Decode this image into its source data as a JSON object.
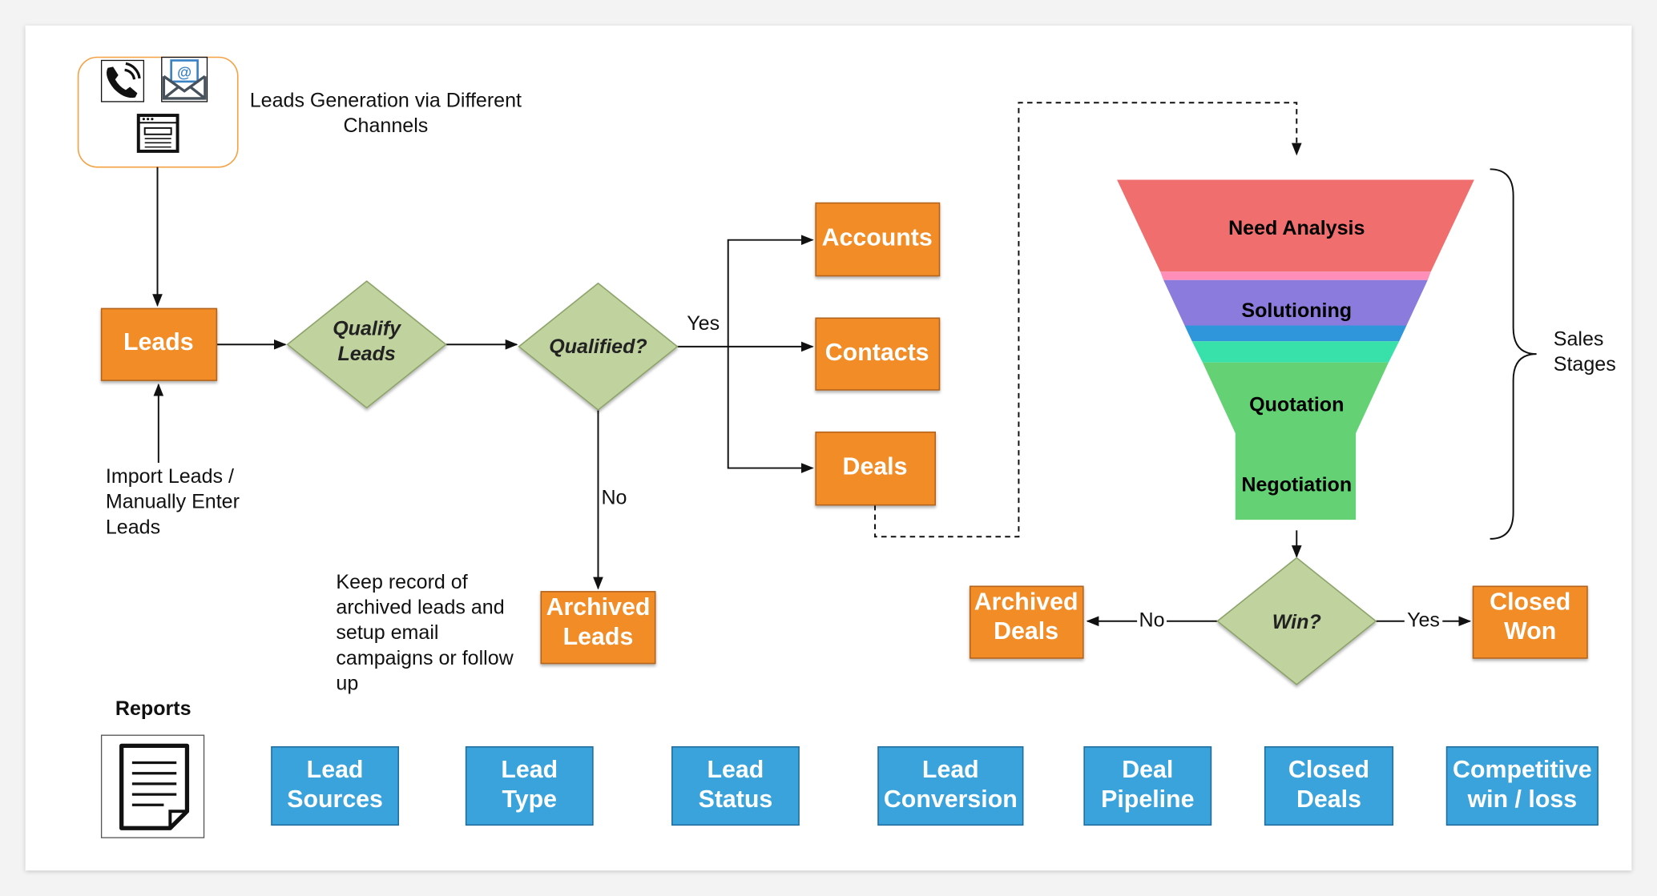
{
  "channels": {
    "label_line1": "Leads Generation via Different",
    "label_line2": "Channels",
    "icons": [
      "phone-icon",
      "email-icon",
      "web-form-icon"
    ]
  },
  "leads": {
    "label": "Leads"
  },
  "import_note": [
    "Import Leads /",
    "Manually Enter",
    "Leads"
  ],
  "qualify": {
    "line1": "Qualify",
    "line2": "Leads"
  },
  "qualified": {
    "label": "Qualified?",
    "yes": "Yes",
    "no": "No"
  },
  "outcomes": {
    "accounts": "Accounts",
    "contacts": "Contacts",
    "deals": "Deals"
  },
  "archived_leads": {
    "line1": "Archived",
    "line2": "Leads"
  },
  "archive_note": [
    "Keep record of",
    "archived leads and",
    "setup email",
    "campaigns or follow",
    "up"
  ],
  "funnel": {
    "stages": [
      "Need Analysis",
      "Solutioning",
      "Quotation",
      "Negotiation"
    ],
    "bracket_label": [
      "Sales",
      "Stages"
    ],
    "colors": {
      "need": "#f06e6e",
      "pink": "#ff8fb8",
      "solution": "#8b7bdc",
      "blue": "#2f96dc",
      "teal": "#38e0aa",
      "green": "#64d274"
    }
  },
  "win": {
    "label": "Win?",
    "no": "No",
    "yes": "Yes"
  },
  "archived_deals": {
    "line1": "Archived",
    "line2": "Deals"
  },
  "closed_won": {
    "line1": "Closed",
    "line2": "Won"
  },
  "reports": {
    "title": "Reports",
    "items": [
      {
        "line1": "Lead",
        "line2": "Sources"
      },
      {
        "line1": "Lead",
        "line2": "Type"
      },
      {
        "line1": "Lead",
        "line2": "Status"
      },
      {
        "line1": "Lead",
        "line2": "Conversion"
      },
      {
        "line1": "Deal",
        "line2": "Pipeline"
      },
      {
        "line1": "Closed",
        "line2": "Deals"
      },
      {
        "line1": "Competitive",
        "line2": "win / loss"
      }
    ]
  },
  "colors": {
    "orange": "#f28c28",
    "blue": "#3aa3dc",
    "diamond": "#c0d39e"
  }
}
